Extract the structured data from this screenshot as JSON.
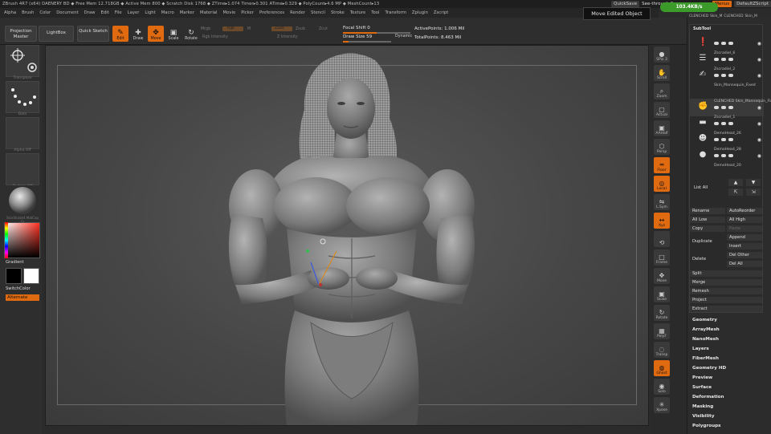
{
  "titlebar": {
    "title": "ZBrush 4R7 (x64)    DAENERY BD     ◆ Free Mem 12.718GB ◆ Active Mem 800 ◆ Scratch Disk 1768 ◆ ZTime▸1.074 Timer▸0.301 ATime▸0.329 ◆ PolyCount▸4.6 MP ◆ MeshCount▸13",
    "quicksave": "QuickSave",
    "see_through_label": "See-through  0",
    "see_through_value": 0,
    "menus_label": "Menus",
    "default_script": "DefaultZScript"
  },
  "tooltip": "Move Edited Object",
  "memory_badge": "103.4KB/s",
  "menubar": [
    "Alpha",
    "Brush",
    "Color",
    "Document",
    "Draw",
    "Edit",
    "File",
    "Layer",
    "Light",
    "Macro",
    "Marker",
    "Material",
    "Movie",
    "Picker",
    "Preferences",
    "Render",
    "Stencil",
    "Stroke",
    "Texture",
    "Tool",
    "Transform",
    "Zplugin",
    "Zscript"
  ],
  "shelf": {
    "projection_master": "Projection Master",
    "lightbox": "LightBox",
    "quick_sketch": "Quick Sketch",
    "tools": [
      {
        "label": "Edit",
        "glyph": "✎",
        "active": true
      },
      {
        "label": "Draw",
        "glyph": "✚",
        "active": false
      },
      {
        "label": "Move",
        "glyph": "✥",
        "active": true
      },
      {
        "label": "Scale",
        "glyph": "▣",
        "active": false
      },
      {
        "label": "Rotate",
        "glyph": "↻",
        "active": false
      }
    ],
    "mrgb": "Mrgb",
    "rgb": "Rgb",
    "m": "M",
    "zadd": "Zadd",
    "zsub": "Zsub",
    "zcut": "Zcut",
    "rgb_intensity": "Rgb Intensity",
    "z_intensity": "Z Intensity",
    "focal_shift_label": "Focal Shift",
    "focal_shift_value": "0",
    "focal_shift_fraction": 0.5,
    "draw_size_label": "Draw Size",
    "draw_size_value": "59",
    "draw_size_fraction": 0.12,
    "dynamic": "Dynamic",
    "active_points": "ActivePoints: 1.006 Mil",
    "total_points": "TotalPoints: 8.463 Mil"
  },
  "leftpanel": {
    "transpose": "Transpose",
    "dots": "Dots",
    "alpha_off": "Alpha Off",
    "texture_off": "Texture Off",
    "material": "SkinShade4 MatCap Gr",
    "gradient": "Gradient",
    "switchcolor": "SwitchColor",
    "alternate": "Alternate",
    "main_color": "#000000",
    "secondary_color": "#ffffff"
  },
  "rightdock": [
    {
      "label": "SPix 3",
      "glyph": "●",
      "orange": false
    },
    {
      "label": "Scroll",
      "glyph": "✋",
      "orange": false
    },
    {
      "label": "Zoom",
      "glyph": "⌕",
      "orange": false
    },
    {
      "label": "Actual",
      "glyph": "▢",
      "orange": false
    },
    {
      "label": "AAHalf",
      "glyph": "▣",
      "orange": false
    },
    {
      "label": "Persp",
      "glyph": "⬡",
      "orange": false
    },
    {
      "label": "Floor",
      "glyph": "═",
      "orange": true
    },
    {
      "label": "Local",
      "glyph": "◎",
      "orange": true
    },
    {
      "label": "L.Sym",
      "glyph": "⇋",
      "orange": false
    },
    {
      "label": "Xyz",
      "glyph": "↔",
      "orange": true
    },
    {
      "label": "",
      "glyph": "⟲",
      "orange": false
    },
    {
      "label": "Frame",
      "glyph": "□",
      "orange": false
    },
    {
      "label": "Move",
      "glyph": "✥",
      "orange": false
    },
    {
      "label": "Scale",
      "glyph": "▣",
      "orange": false
    },
    {
      "label": "Rotate",
      "glyph": "↻",
      "orange": false
    },
    {
      "label": "PolyF",
      "glyph": "▦",
      "orange": false
    },
    {
      "label": "Transp",
      "glyph": "◌",
      "orange": false
    },
    {
      "label": "Ghost",
      "glyph": "◍",
      "orange": true
    },
    {
      "label": "Solo",
      "glyph": "◉",
      "orange": false
    },
    {
      "label": "Xpose",
      "glyph": "✳",
      "orange": false
    }
  ],
  "subtool": {
    "header": "SubTool",
    "top_tabs": [
      "CLENCHED",
      "Skin_M",
      "CLENCHED",
      "Skin_M"
    ],
    "items": [
      {
        "name": "",
        "glyph": "❗",
        "selected": false
      },
      {
        "name": "Zscradiel_6",
        "glyph": "☰",
        "selected": false
      },
      {
        "name": "Zscradiel_2",
        "glyph": "✍",
        "selected": false
      },
      {
        "name": "Skin_Mannequin_Fixed",
        "glyph": "",
        "selected": false
      },
      {
        "name": "CLENCHED  Skin_Mannequin_Fixed",
        "glyph": "✊",
        "selected": true
      },
      {
        "name": "Zscradiel_1",
        "glyph": "▬",
        "selected": false
      },
      {
        "name": "DemoHead_26",
        "glyph": "☻",
        "selected": false
      },
      {
        "name": "DemoHead_28",
        "glyph": "●",
        "selected": false
      },
      {
        "name": "DemoHead_20",
        "glyph": "",
        "selected": false
      }
    ],
    "list_all": "List All",
    "rename": "Rename",
    "auto_reorder": "AutoReorder",
    "all_low": "All Low",
    "all_high": "All High",
    "copy": "Copy",
    "paste": "Paste",
    "duplicate": "Duplicate",
    "append": "Append",
    "insert": "Insert",
    "delete": "Delete",
    "del_other": "Del Other",
    "del_all": "Del All",
    "split": "Split",
    "merge": "Merge",
    "remesh": "Remesh",
    "project": "Project",
    "extract": "Extract"
  },
  "sections": [
    "Geometry",
    "ArrayMesh",
    "NanoMesh",
    "Layers",
    "FiberMesh",
    "Geometry HD",
    "Preview",
    "Surface",
    "Deformation",
    "Masking",
    "Visibility",
    "Polygroups"
  ]
}
